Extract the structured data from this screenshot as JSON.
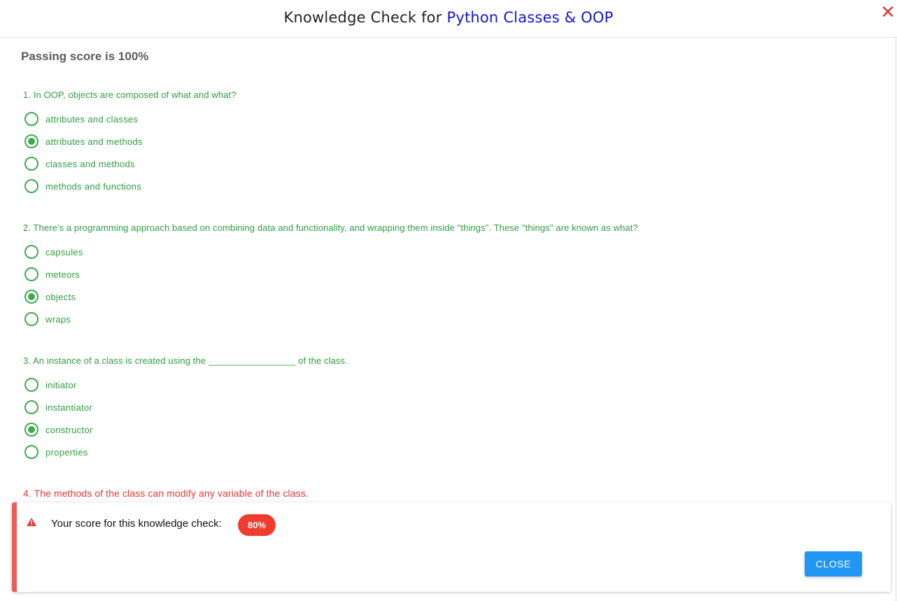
{
  "header": {
    "title_prefix": "Knowledge Check for ",
    "title_topic": "Python Classes & OOP",
    "close_symbol": "✕"
  },
  "passing_score": "Passing score is 100%",
  "questions": [
    {
      "text": "1. In OOP, objects are composed of what and what?",
      "status": "correct",
      "options": [
        {
          "label": "attributes and classes",
          "selected": false
        },
        {
          "label": "attributes and methods",
          "selected": true
        },
        {
          "label": "classes and methods",
          "selected": false
        },
        {
          "label": "methods and functions",
          "selected": false
        }
      ]
    },
    {
      "text": "2. There's a programming approach based on combining data and functionality, and wrapping them inside \"things\". These \"things\" are known as what?",
      "status": "correct",
      "options": [
        {
          "label": "capsules",
          "selected": false
        },
        {
          "label": "meteors",
          "selected": false
        },
        {
          "label": "objects",
          "selected": true
        },
        {
          "label": "wraps",
          "selected": false
        }
      ]
    },
    {
      "text": "3. An instance of a class is created using the _________________ of the class.",
      "status": "correct",
      "options": [
        {
          "label": "initiator",
          "selected": false
        },
        {
          "label": "instantiator",
          "selected": false
        },
        {
          "label": "constructor",
          "selected": true
        },
        {
          "label": "properties",
          "selected": false
        }
      ]
    },
    {
      "text": "4. The methods of the class can modify any variable of the class.",
      "status": "wrong",
      "options": []
    }
  ],
  "result": {
    "message": "Your score for this knowledge check:",
    "score": "80%",
    "close_label": "CLOSE"
  },
  "colors": {
    "correct": "#2e9e3f",
    "wrong": "#e53935",
    "topic": "#1414d8",
    "badge": "#f03c2e",
    "button": "#2196f3",
    "panel_border": "#f05a5a"
  },
  "icons": {
    "close": "close-icon",
    "radio": "radio-icon",
    "warning": "warning-icon"
  }
}
